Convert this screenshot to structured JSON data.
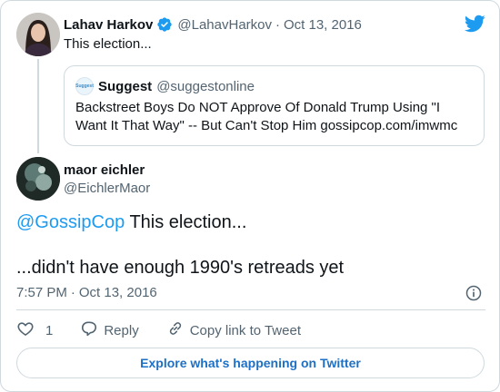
{
  "parent_tweet": {
    "author_name": "Lahav Harkov",
    "author_handle": "@LahavHarkov",
    "separator": "·",
    "date": "Oct 13, 2016",
    "text": "This election...",
    "verified_icon": "verified-badge-icon",
    "quoted": {
      "author_name": "Suggest",
      "author_handle": "@suggestonline",
      "avatar_text": "Suggest",
      "text": "Backstreet Boys Do NOT Approve Of Donald Trump Using \"I Want It That Way\" -- But Can't Stop Him gossipcop.com/imwmc"
    }
  },
  "tweet": {
    "author_name": "maor eichler",
    "author_handle": "@EichlerMaor",
    "mention": "@GossipCop",
    "line1_rest": " This election...",
    "line2": "...didn't have enough 1990's retreads yet",
    "time": "7:57 PM",
    "separator": "·",
    "date": "Oct 13, 2016"
  },
  "actions": {
    "like_count": "1",
    "reply_label": "Reply",
    "copy_link_label": "Copy link to Tweet"
  },
  "explore_label": "Explore what's happening on Twitter",
  "colors": {
    "accent": "#1d9bf0",
    "explore_text": "#1d70c4",
    "secondary_text": "#536471",
    "border": "#cfd9de"
  },
  "icons": {
    "brand": "twitter-bird-icon",
    "info": "info-icon",
    "like": "heart-icon",
    "reply": "speech-bubble-icon",
    "copy_link": "link-icon"
  }
}
